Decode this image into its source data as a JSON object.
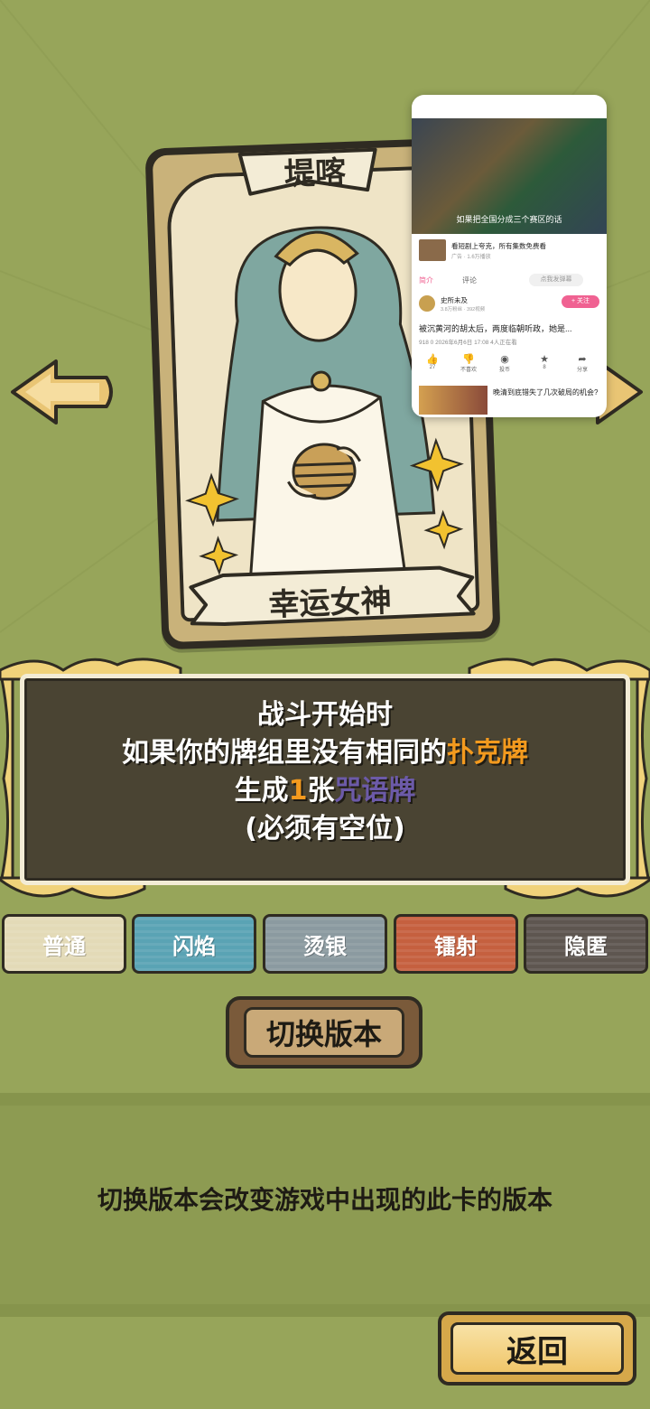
{
  "card": {
    "title": "堤喀",
    "name": "幸运女神"
  },
  "description": {
    "line1": "战斗开始时",
    "line2_before": "如果你的牌组里没有相同的",
    "line2_highlight": "扑克牌",
    "line3_before": "生成",
    "line3_number": "1",
    "line3_mid": "张",
    "line3_highlight": "咒语牌",
    "line4": "(必须有空位)"
  },
  "versions": [
    {
      "label": "普通",
      "color": "#e3dab7"
    },
    {
      "label": "闪焰",
      "color": "#5aa3b4"
    },
    {
      "label": "烫银",
      "color": "#8b9aa0"
    },
    {
      "label": "镭射",
      "color": "#c5603f"
    },
    {
      "label": "隐匿",
      "color": "#5e5650"
    }
  ],
  "switch_button": {
    "label": "切换版本"
  },
  "info": {
    "text": "切换版本会改变游戏中出现的此卡的版本"
  },
  "back_button": {
    "label": "返回"
  },
  "popup": {
    "video_caption": "如果把全国分成三个赛区的话",
    "ad_title": "看短剧上夸克，所有集数免费看",
    "ad_sub": "广告 · 1.6万播放",
    "tab_intro": "简介",
    "tab_comments": "评论",
    "danmaku_placeholder": "点我发弹幕",
    "author_name": "史所未及",
    "author_sub": "3.8万粉丝 · 392视频",
    "follow_label": "+ 关注",
    "video_title": "被沉黄河的胡太后，两度临朝听政，她是...",
    "meta": "918   0   2026年6月6日 17:08   4人正在看",
    "actions": [
      {
        "icon": "thumbs-up-icon",
        "glyph": "👍",
        "label": "27"
      },
      {
        "icon": "thumbs-down-icon",
        "glyph": "👎",
        "label": "不喜欢"
      },
      {
        "icon": "coin-icon",
        "glyph": "◉",
        "label": "投币"
      },
      {
        "icon": "star-icon",
        "glyph": "★",
        "label": "8"
      },
      {
        "icon": "share-icon",
        "glyph": "➦",
        "label": "分享"
      }
    ],
    "rec_title": "晚清到底错失了几次破局的机会?"
  }
}
